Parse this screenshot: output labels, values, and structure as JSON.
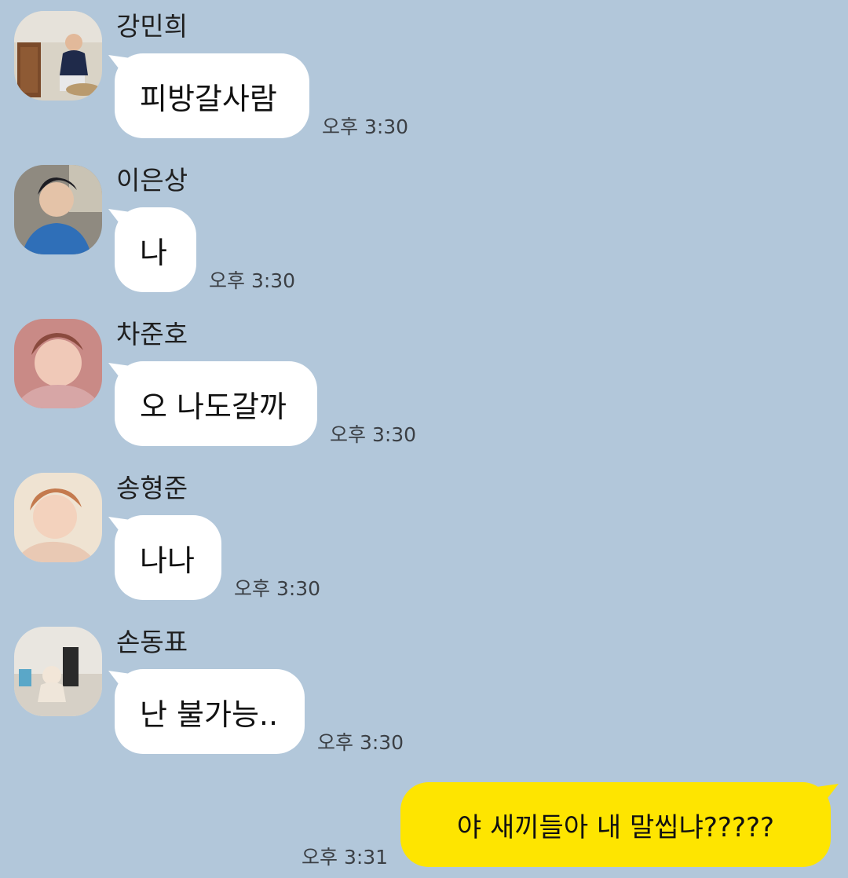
{
  "colors": {
    "background": "#b2c7da",
    "incoming_bubble": "#ffffff",
    "outgoing_bubble": "#fee500"
  },
  "messages": [
    {
      "sender": "강민희",
      "text": "피방갈사람",
      "time": "오후 3:30",
      "avatar_icon": "profile-photo"
    },
    {
      "sender": "이은상",
      "text": "나",
      "time": "오후 3:30",
      "avatar_icon": "profile-photo"
    },
    {
      "sender": "차준호",
      "text": "오 나도갈까",
      "time": "오후 3:30",
      "avatar_icon": "profile-photo"
    },
    {
      "sender": "송형준",
      "text": "나나",
      "time": "오후 3:30",
      "avatar_icon": "profile-photo"
    },
    {
      "sender": "손동표",
      "text": "난 불가능..",
      "time": "오후 3:30",
      "avatar_icon": "profile-photo"
    }
  ],
  "my_message": {
    "text": "야 새끼들아 내 말씹냐?????",
    "time": "오후 3:31"
  }
}
